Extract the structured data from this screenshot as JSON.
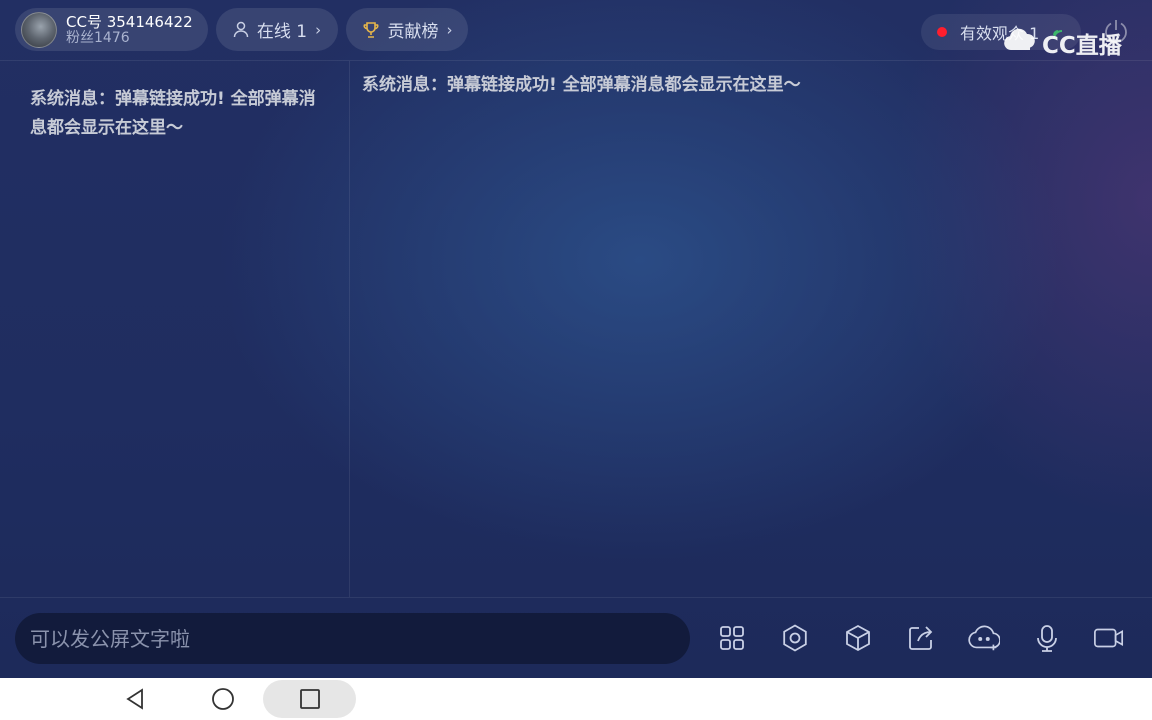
{
  "header": {
    "user": {
      "id_label": "CC号 354146422",
      "fans_label": "粉丝1476"
    },
    "online": {
      "label": "在线 1"
    },
    "contribution": {
      "label": "贡献榜"
    },
    "viewers": {
      "label": "有效观众 1"
    },
    "logo": {
      "text": "CC直播"
    }
  },
  "left_panel": {
    "system_message": "系统消息：弹幕链接成功! 全部弹幕消息都会显示在这里～"
  },
  "main_panel": {
    "system_message": "系统消息：弹幕链接成功! 全部弹幕消息都会显示在这里～"
  },
  "bottom": {
    "chat_placeholder": "可以发公屏文字啦",
    "tools": [
      "apps-icon",
      "settings-icon",
      "cube-icon",
      "share-icon",
      "face-icon",
      "microphone-icon",
      "camera-icon"
    ]
  },
  "colors": {
    "background": "#1f2b5c",
    "live_dot": "#ff1e2d",
    "message_text": "#c7cbd6",
    "input_bg": "#121b3c"
  }
}
